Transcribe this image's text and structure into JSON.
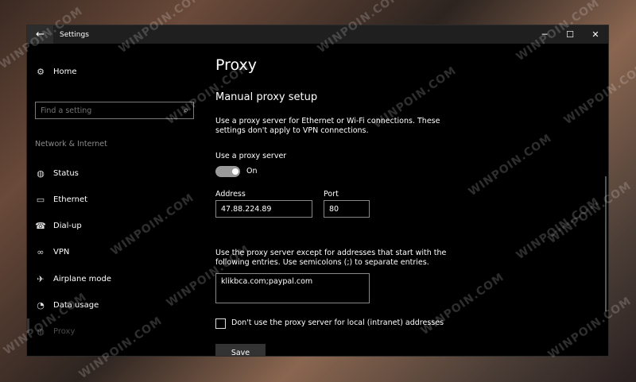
{
  "window": {
    "title": "Settings",
    "back_icon": "←",
    "minimize_icon": "─",
    "maximize_icon": "☐",
    "close_icon": "✕"
  },
  "sidebar": {
    "home": {
      "label": "Home",
      "icon": "gear-icon"
    },
    "search_placeholder": "Find a setting",
    "section_label": "Network & Internet",
    "items": [
      {
        "label": "Status",
        "icon": "globe-icon"
      },
      {
        "label": "Ethernet",
        "icon": "monitor-icon"
      },
      {
        "label": "Dial-up",
        "icon": "phone-icon"
      },
      {
        "label": "VPN",
        "icon": "vpn-icon"
      },
      {
        "label": "Airplane mode",
        "icon": "airplane-icon"
      },
      {
        "label": "Data usage",
        "icon": "pie-icon"
      },
      {
        "label": "Proxy",
        "icon": "globe-icon",
        "selected": true
      }
    ]
  },
  "main": {
    "page_title": "Proxy",
    "section_title": "Manual proxy setup",
    "description": "Use a proxy server for Ethernet or Wi-Fi connections. These settings don't apply to VPN connections.",
    "toggle": {
      "label": "Use a proxy server",
      "state": "On",
      "on": true
    },
    "address": {
      "label": "Address",
      "value": "47.88.224.89"
    },
    "port": {
      "label": "Port",
      "value": "80"
    },
    "exceptions": {
      "description": "Use the proxy server except for addresses that start with the following entries. Use semicolons (;) to separate entries.",
      "value": "klikbca.com;paypal.com"
    },
    "local_bypass": {
      "label": "Don't use the proxy server for local (intranet) addresses",
      "checked": false
    },
    "save_label": "Save"
  },
  "watermark": "WINPOIN.COM"
}
